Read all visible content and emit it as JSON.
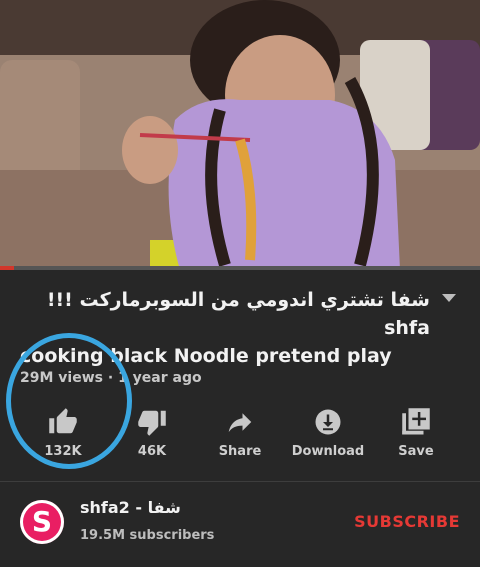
{
  "video": {
    "progress": 0.03,
    "colors": {
      "progress": "#d2362b"
    }
  },
  "title": {
    "line1": "شفا تشتري اندومي من السوبرماركت !!! shfa",
    "line2": "cooking black Noodle pretend play"
  },
  "meta": {
    "views": "29M views",
    "separator": "·",
    "age": "1 year ago"
  },
  "actions": [
    {
      "icon": "thumbs-up-icon",
      "label": "132K"
    },
    {
      "icon": "thumbs-down-icon",
      "label": "46K"
    },
    {
      "icon": "share-icon",
      "label": "Share"
    },
    {
      "icon": "download-icon",
      "label": "Download"
    },
    {
      "icon": "save-icon",
      "label": "Save"
    }
  ],
  "channel": {
    "avatar_letter": "S",
    "name": "shfa2 - شفا",
    "subscribers": "19.5M subscribers",
    "subscribe_label": "SUBSCRIBE",
    "colors": {
      "avatar": "#e91e63",
      "subscribe": "#e53935"
    }
  },
  "annotation": {
    "color": "#3aa6e0"
  }
}
